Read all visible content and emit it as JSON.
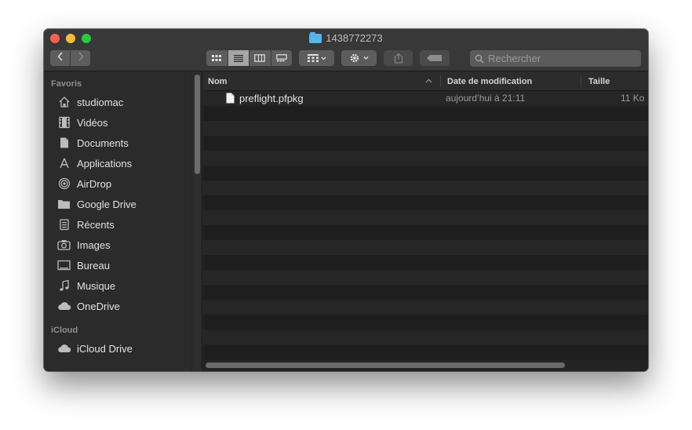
{
  "window": {
    "title": "1438772273",
    "folder_color": "#58b4ea"
  },
  "toolbar": {
    "back_icon": "chevron-left-icon",
    "forward_icon": "chevron-right-icon",
    "views": [
      "icon-view-icon",
      "list-view-icon",
      "column-view-icon",
      "gallery-view-icon"
    ],
    "active_view": "list",
    "group_icon": "group-icon",
    "action_icon": "gear-icon",
    "share_icon": "share-icon",
    "tag_icon": "tag-icon"
  },
  "search": {
    "placeholder": "Rechercher",
    "value": ""
  },
  "sidebar": {
    "sections": [
      {
        "label": "Favoris",
        "items": [
          {
            "label": "studiomac",
            "icon": "home-icon"
          },
          {
            "label": "Vidéos",
            "icon": "film-icon"
          },
          {
            "label": "Documents",
            "icon": "document-icon"
          },
          {
            "label": "Applications",
            "icon": "applications-icon"
          },
          {
            "label": "AirDrop",
            "icon": "airdrop-icon"
          },
          {
            "label": "Google Drive",
            "icon": "folder-icon"
          },
          {
            "label": "Récents",
            "icon": "recents-icon"
          },
          {
            "label": "Images",
            "icon": "camera-icon"
          },
          {
            "label": "Bureau",
            "icon": "desktop-icon"
          },
          {
            "label": "Musique",
            "icon": "music-icon"
          },
          {
            "label": "OneDrive",
            "icon": "cloud-icon"
          }
        ]
      },
      {
        "label": "iCloud",
        "items": [
          {
            "label": "iCloud Drive",
            "icon": "cloud-icon"
          }
        ]
      }
    ]
  },
  "list": {
    "columns": [
      "Nom",
      "Date de modification",
      "Taille"
    ],
    "files": [
      {
        "name": "preflight.pfpkg",
        "modified": "aujourd’hui à 21:11",
        "size": "11 Ko",
        "icon": "file-icon"
      }
    ]
  }
}
